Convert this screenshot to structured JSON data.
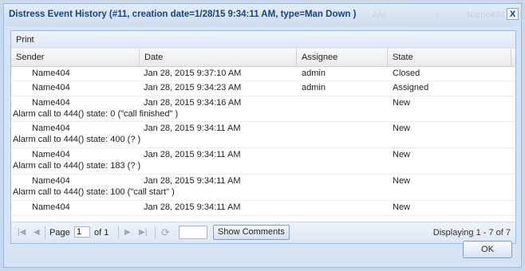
{
  "window": {
    "title": "Distress Event History (#11, creation date=1/28/15 9:34:11 AM, type=Man Down )",
    "ghost_left": "AM",
    "ghost_right": "Name404",
    "close_label": "X"
  },
  "toolbar": {
    "print_label": "Print"
  },
  "columns": [
    "Sender",
    "Date",
    "Assignee",
    "State"
  ],
  "rows": [
    {
      "sender": "Name404",
      "date": "Jan 28, 2015 9:37:10 AM",
      "assignee": "admin",
      "state": "Closed",
      "comment": ""
    },
    {
      "sender": "Name404",
      "date": "Jan 28, 2015 9:34:23 AM",
      "assignee": "admin",
      "state": "Assigned",
      "comment": ""
    },
    {
      "sender": "Name404",
      "date": "Jan 28, 2015 9:34:16 AM",
      "assignee": "",
      "state": "New",
      "comment": "Alarm call to 444() state: 0 (\"call finished\" )"
    },
    {
      "sender": "Name404",
      "date": "Jan 28, 2015 9:34:11 AM",
      "assignee": "",
      "state": "New",
      "comment": "Alarm call to 444() state: 400 (? )"
    },
    {
      "sender": "Name404",
      "date": "Jan 28, 2015 9:34:11 AM",
      "assignee": "",
      "state": "New",
      "comment": "Alarm call to 444() state: 183 (? )"
    },
    {
      "sender": "Name404",
      "date": "Jan 28, 2015 9:34:11 AM",
      "assignee": "",
      "state": "New",
      "comment": "Alarm call to 444() state: 100 (\"call start\" )"
    },
    {
      "sender": "Name404",
      "date": "Jan 28, 2015 9:34:11 AM",
      "assignee": "",
      "state": "New",
      "comment": ""
    }
  ],
  "pager": {
    "page_label": "Page",
    "page_value": "1",
    "of_label": "of 1",
    "show_comments_label": "Show Comments",
    "display_text": "Displaying 1 - 7 of 7",
    "icons": {
      "first": "first-page-icon",
      "prev": "prev-page-icon",
      "next": "next-page-icon",
      "last": "last-page-icon",
      "refresh": "refresh-icon"
    }
  },
  "footer": {
    "ok_label": "OK"
  },
  "colors": {
    "title_text": "#15428b",
    "border": "#99bbe8",
    "background": "#d6e3f2"
  }
}
